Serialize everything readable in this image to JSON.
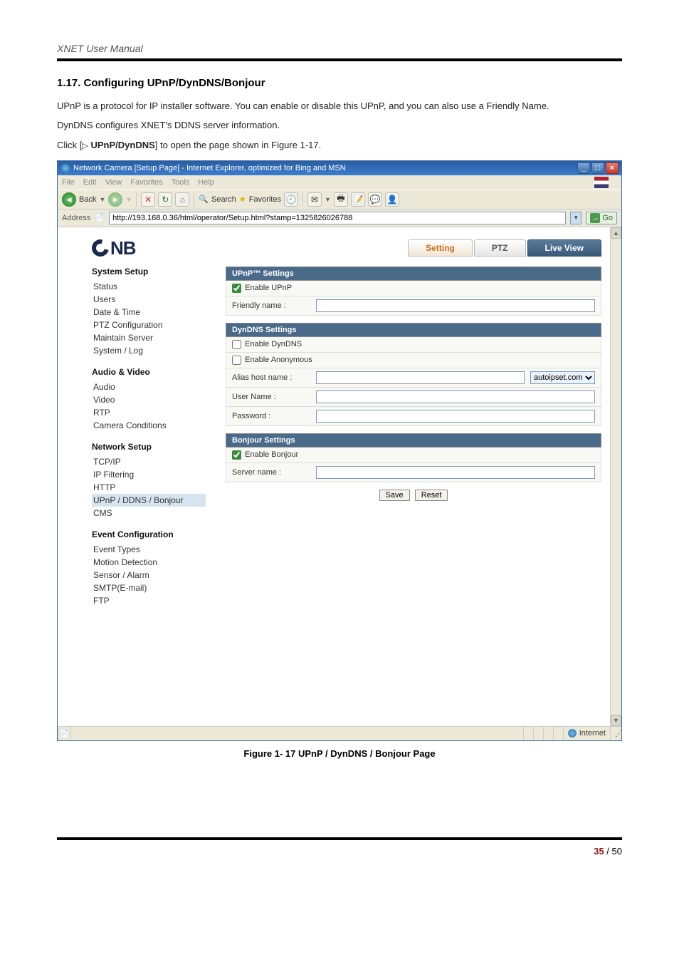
{
  "doc": {
    "header": "XNET User Manual",
    "section_number": "1.17.",
    "section_title": "Configuring UPnP/DynDNS/Bonjour",
    "para1": "UPnP is a protocol for IP installer software. You can enable or disable this UPnP, and you can also use a Friendly Name.",
    "para2": "DynDNS configures XNET's DDNS server information.",
    "para3_pre": "Click [",
    "para3_bold": "UPnP/DynDNS",
    "para3_post": "] to open the page shown in Figure 1-17.",
    "triangle": "▷",
    "figure_caption": "Figure 1- 17 UPnP / DynDNS / Bonjour Page",
    "page_current": "35",
    "page_sep": " / ",
    "page_total": "50"
  },
  "browser": {
    "title": "Network Camera [Setup Page] - Internet Explorer, optimized for Bing and MSN",
    "menus": [
      "File",
      "Edit",
      "View",
      "Favorites",
      "Tools",
      "Help"
    ],
    "back": "Back",
    "search": "Search",
    "favorites": "Favorites",
    "addr_label": "Address",
    "url": "http://193.168.0.36/html/operator/Setup.html?stamp=1325826026788",
    "go": "Go",
    "status_zone": "Internet"
  },
  "app": {
    "logo": "CNB",
    "tabs": {
      "setting": "Setting",
      "ptz": "PTZ",
      "live": "Live View"
    },
    "sidebar": {
      "g1": {
        "head": "System Setup",
        "items": [
          "Status",
          "Users",
          "Date & Time",
          "PTZ Configuration",
          "Maintain Server",
          "System / Log"
        ]
      },
      "g2": {
        "head": "Audio & Video",
        "items": [
          "Audio",
          "Video",
          "RTP",
          "Camera Conditions"
        ]
      },
      "g3": {
        "head": "Network Setup",
        "items": [
          "TCP/IP",
          "IP Filtering",
          "HTTP",
          "UPnP / DDNS / Bonjour",
          "CMS"
        ],
        "active_index": 3
      },
      "g4": {
        "head": "Event Configuration",
        "items": [
          "Event Types",
          "Motion Detection",
          "Sensor / Alarm",
          "SMTP(E-mail)",
          "FTP"
        ]
      }
    },
    "form": {
      "upnp_head": "UPnP™ Settings",
      "enable_upnp": "Enable UPnP",
      "friendly_name": "Friendly name :",
      "dyn_head": "DynDNS Settings",
      "enable_dyndns": "Enable DynDNS",
      "enable_anon": "Enable Anonymous",
      "alias_host": "Alias host name :",
      "alias_domain": "autoipset.com",
      "user_name": "User Name :",
      "password": "Password :",
      "bonjour_head": "Bonjour Settings",
      "enable_bonjour": "Enable Bonjour",
      "server_name": "Server name :",
      "save": "Save",
      "reset": "Reset"
    }
  }
}
